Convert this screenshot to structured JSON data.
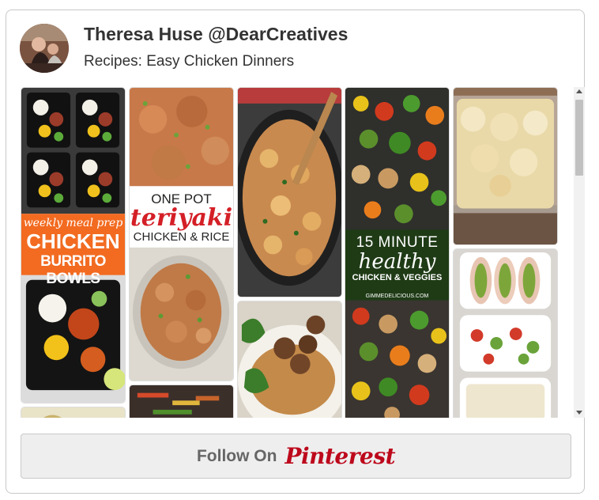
{
  "profile": {
    "name": "Theresa Huse @DearCreatives",
    "board": "Recipes: Easy Chicken Dinners"
  },
  "pins": {
    "burrito": {
      "line1": "weekly meal prep",
      "line2": "CHICKEN",
      "line3": "BURRITO BOWLS"
    },
    "teriyaki": {
      "line1": "ONE POT",
      "line2": "teriyaki",
      "line3": "CHICKEN & RICE"
    },
    "veggies": {
      "line1": "15 MINUTE",
      "line2": "healthy",
      "line3": "CHICKEN & VEGGIES",
      "credit": "GIMMEDELICIOUS.COM"
    }
  },
  "follow_button": {
    "label": "Follow On",
    "brand": "Pinterest"
  },
  "colors": {
    "pinterest_red": "#bd081c",
    "orange_banner": "#f26b21",
    "dark_green_banner": "#1f3b16"
  }
}
